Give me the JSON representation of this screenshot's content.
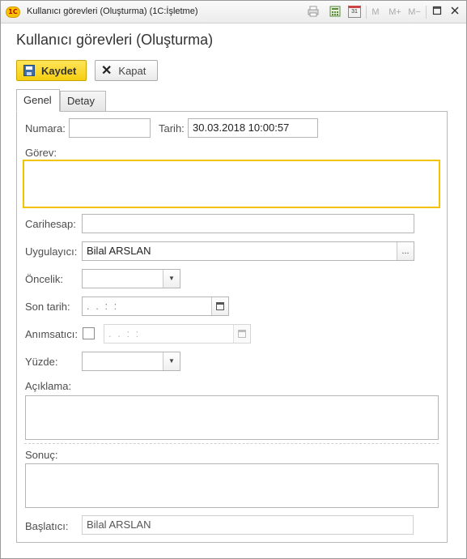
{
  "window": {
    "logo_text": "1C",
    "title": "Kullanıcı görevleri (Oluşturma)  (1C:İşletme)",
    "toolbar_icons": [
      "print-icon",
      "calculator-icon",
      "calendar-icon",
      "memory-m-icon",
      "memory-plus-icon",
      "memory-minus-icon",
      "restore-icon",
      "close-icon"
    ],
    "m_label": "M",
    "mplus_label": "M+",
    "mminus_label": "M−",
    "cal_day": "31"
  },
  "form": {
    "heading": "Kullanıcı görevleri (Oluşturma)"
  },
  "toolbar": {
    "save_label": "Kaydet",
    "close_label": "Kapat"
  },
  "tabs": [
    {
      "label": "Genel",
      "active": true
    },
    {
      "label": "Detay",
      "active": false
    }
  ],
  "fields": {
    "numara_label": "Numara:",
    "numara_value": "",
    "tarih_label": "Tarih:",
    "tarih_value": "30.03.2018 10:00:57",
    "gorev_label": "Görev:",
    "gorev_value": "",
    "carihesap_label": "Carihesap:",
    "carihesap_value": "",
    "uygulayici_label": "Uygulayıcı:",
    "uygulayici_value": "Bilal ARSLAN",
    "oncelik_label": "Öncelik:",
    "oncelik_value": "",
    "son_tarih_label": "Son tarih:",
    "son_tarih_mask": " .  .      :  :",
    "animsatici_label": "Anımsatıcı:",
    "animsatici_checked": false,
    "animsatici_mask": " .  .      :  :",
    "yuzde_label": "Yüzde:",
    "yuzde_value": "",
    "aciklama_label": "Açıklama:",
    "aciklama_value": "",
    "sonuc_label": "Sonuç:",
    "sonuc_value": "",
    "baslatici_label": "Başlatıcı:",
    "baslatici_value": "Bilal ARSLAN"
  },
  "colors": {
    "accent_yellow": "#f5cf0f",
    "focus_border": "#f2c400"
  }
}
